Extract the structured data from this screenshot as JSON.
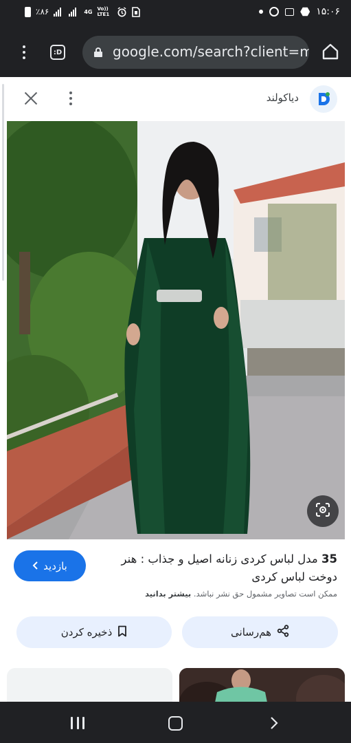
{
  "status_bar": {
    "time": "۱۵:۰۶",
    "battery": "٪۸۶",
    "network_4g": "4G",
    "network_volte": "Vo)) LTE1"
  },
  "browser": {
    "url": "google.com/search?client=m",
    "tab_switcher_label": ":D"
  },
  "sheet": {
    "site_name": "دیاکولند"
  },
  "result": {
    "title_number": "35",
    "title_text": " مدل لباس کردی زنانه اصیل و جذاب : هنر دوخت لباس کردی",
    "copyright_notice": "ممکن است تصاویر مشمول حق نشر نباشد.",
    "learn_more": "بیشتر بدانید",
    "visit_label": "بازدید",
    "share_label": "هم‌رسانی",
    "save_label": "ذخیره کردن"
  },
  "colors": {
    "accent": "#1a73e8",
    "chrome_dark": "#202124",
    "tonal_button": "#e8f0fe"
  },
  "icons": [
    "battery-icon",
    "signal-icon",
    "alarm-icon",
    "chrome-icon",
    "image-icon",
    "lock-icon",
    "home-icon",
    "close-icon",
    "more-vert-icon",
    "google-lens-icon",
    "share-icon",
    "bookmark-icon",
    "chevron-left-icon"
  ]
}
